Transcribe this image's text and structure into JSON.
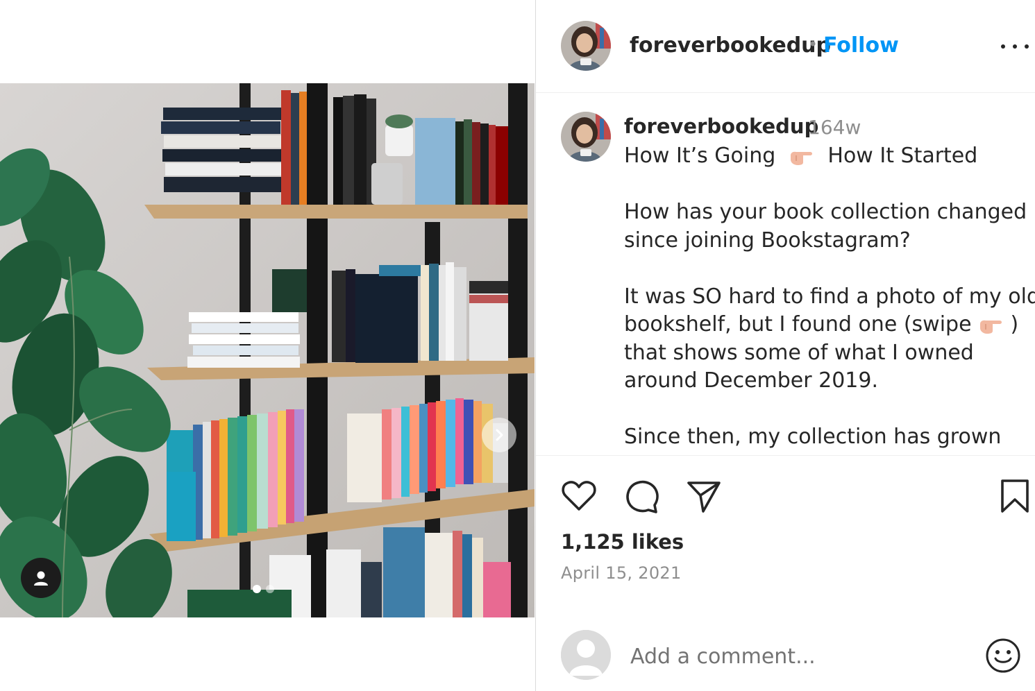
{
  "post": {
    "author": "foreverbookedup",
    "follow_label": "Follow",
    "separator": "•",
    "caption": {
      "username": "foreverbookedup",
      "time_ago": "164w",
      "line1_a": "How It’s Going",
      "line1_b": "How It Started",
      "para1": [
        "How has your book collection changed",
        "since joining Bookstagram?"
      ],
      "para2_l1": "It was SO hard to find a photo of my old",
      "para2_l2_a": "bookshelf, but I found one (swipe",
      "para2_l2_b": ")",
      "para2_l3": "that shows some of what I owned",
      "para2_l4": "around December 2019.",
      "para3": "Since then, my collection has grown"
    },
    "likes": "1,125 likes",
    "date": "April 15, 2021",
    "comment_placeholder": "Add a comment...",
    "carousel": {
      "slide_count": 2,
      "active_index": 0
    }
  },
  "icons": {
    "more": "more-options-icon",
    "like": "heart-icon",
    "comment": "comment-bubble-icon",
    "share": "paper-plane-icon",
    "save": "bookmark-icon",
    "emoji": "smiley-icon",
    "tags": "user-tag-icon",
    "next": "chevron-right-icon",
    "pointing": "pointing-right-hand-icon"
  },
  "colors": {
    "follow": "#0095f6",
    "secondary_text": "#8e8e8e",
    "primary_text": "#262626"
  }
}
